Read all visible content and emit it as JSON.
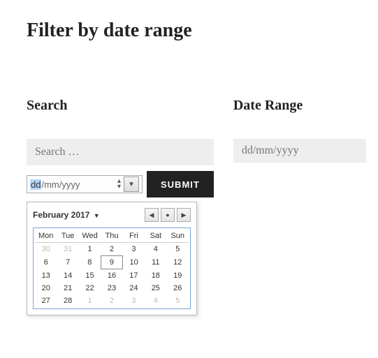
{
  "title": "Filter by date range",
  "searchHeading": "Search",
  "dateRangeHeading": "Date Range",
  "searchPlaceholder": "Search …",
  "dateRangePlaceholder": "dd/mm/yyyy",
  "nativeDate": {
    "segDD": "dd",
    "segRest": "/mm/yyyy"
  },
  "submitLabel": "SUBMIT",
  "datepicker": {
    "monthLabel": "February 2017",
    "navPrev": "◀",
    "navToday": "●",
    "navNext": "▶",
    "weekdays": [
      "Mon",
      "Tue",
      "Wed",
      "Thu",
      "Fri",
      "Sat",
      "Sun"
    ],
    "weeks": [
      [
        {
          "d": "30",
          "other": true
        },
        {
          "d": "31",
          "other": true
        },
        {
          "d": "1"
        },
        {
          "d": "2"
        },
        {
          "d": "3"
        },
        {
          "d": "4"
        },
        {
          "d": "5"
        }
      ],
      [
        {
          "d": "6"
        },
        {
          "d": "7"
        },
        {
          "d": "8"
        },
        {
          "d": "9",
          "today": true
        },
        {
          "d": "10"
        },
        {
          "d": "11"
        },
        {
          "d": "12"
        }
      ],
      [
        {
          "d": "13"
        },
        {
          "d": "14"
        },
        {
          "d": "15"
        },
        {
          "d": "16"
        },
        {
          "d": "17"
        },
        {
          "d": "18"
        },
        {
          "d": "19"
        }
      ],
      [
        {
          "d": "20"
        },
        {
          "d": "21"
        },
        {
          "d": "22"
        },
        {
          "d": "23"
        },
        {
          "d": "24"
        },
        {
          "d": "25"
        },
        {
          "d": "26"
        }
      ],
      [
        {
          "d": "27"
        },
        {
          "d": "28"
        },
        {
          "d": "1",
          "other": true
        },
        {
          "d": "2",
          "other": true
        },
        {
          "d": "3",
          "other": true
        },
        {
          "d": "4",
          "other": true
        },
        {
          "d": "5",
          "other": true
        }
      ]
    ]
  }
}
